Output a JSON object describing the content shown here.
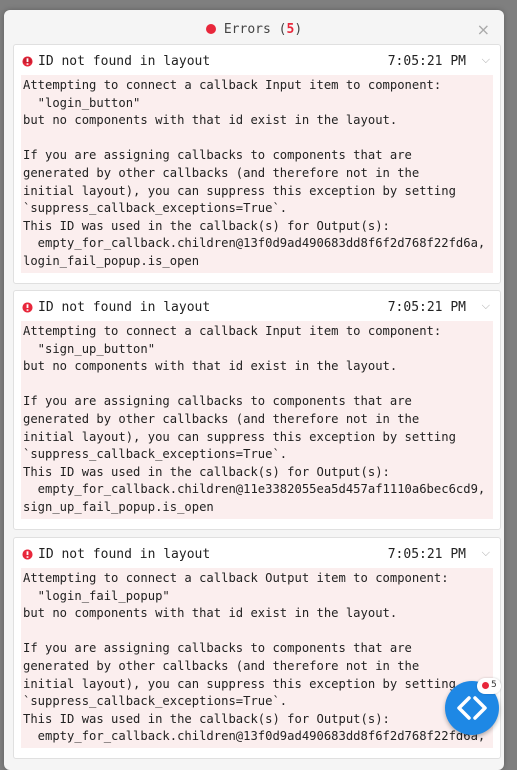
{
  "header": {
    "label": "Errors",
    "open_paren": " (",
    "count": "5",
    "close_paren": ")",
    "close_symbol": "×"
  },
  "errors": [
    {
      "title": "ID not found in layout",
      "time": "7:05:21 PM",
      "message": "Attempting to connect a callback Input item to component:\n  \"login_button\"\nbut no components with that id exist in the layout.\n\nIf you are assigning callbacks to components that are\ngenerated by other callbacks (and therefore not in the\ninitial layout), you can suppress this exception by setting\n`suppress_callback_exceptions=True`.\nThis ID was used in the callback(s) for Output(s):\n  empty_for_callback.children@13f0d9ad490683dd8f6f2d768f22fd6a,\nlogin_fail_popup.is_open"
    },
    {
      "title": "ID not found in layout",
      "time": "7:05:21 PM",
      "message": "Attempting to connect a callback Input item to component:\n  \"sign_up_button\"\nbut no components with that id exist in the layout.\n\nIf you are assigning callbacks to components that are\ngenerated by other callbacks (and therefore not in the\ninitial layout), you can suppress this exception by setting\n`suppress_callback_exceptions=True`.\nThis ID was used in the callback(s) for Output(s):\n  empty_for_callback.children@11e3382055ea5d457af1110a6bec6cd9,\nsign_up_fail_popup.is_open"
    },
    {
      "title": "ID not found in layout",
      "time": "7:05:21 PM",
      "message": "Attempting to connect a callback Output item to component:\n  \"login_fail_popup\"\nbut no components with that id exist in the layout.\n\nIf you are assigning callbacks to components that are\ngenerated by other callbacks (and therefore not in the\ninitial layout), you can suppress this exception by setting\n`suppress_callback_exceptions=True`.\nThis ID was used in the callback(s) for Output(s):\n  empty_for_callback.children@13f0d9ad490683dd8f6f2d768f22fd6a,"
    }
  ],
  "debug_menu": {
    "error_count": "5"
  },
  "colors": {
    "error_red": "#e8273b",
    "message_bg": "#fbeeee",
    "fab_blue": "#1e88e5"
  }
}
